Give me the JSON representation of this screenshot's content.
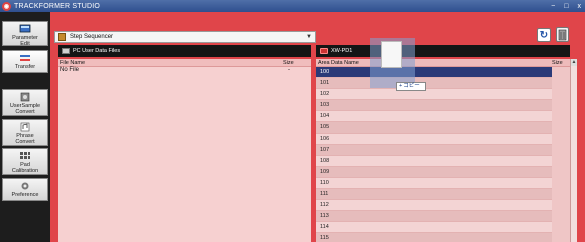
{
  "window": {
    "title": "TRACKFORMER STUDIO",
    "controls": [
      "−",
      "□",
      "x"
    ]
  },
  "sidebar": {
    "items": [
      {
        "label": "Parameter\nEdit",
        "icon": "parameter-edit-icon"
      },
      {
        "label": "Transfer",
        "icon": "transfer-icon"
      },
      {
        "label": "UserSample\nConvert",
        "icon": "usersample-convert-icon"
      },
      {
        "label": "Phrase\nConvert",
        "icon": "phrase-convert-icon"
      },
      {
        "label": "Pad\nCalibration",
        "icon": "pad-calibration-icon"
      },
      {
        "label": "Preference",
        "icon": "preference-icon"
      }
    ]
  },
  "toolbar": {
    "sequencer_select": "Step Sequencer"
  },
  "left_panel": {
    "title": "PC User Data Files",
    "columns": {
      "name": "File Name",
      "size": "Size"
    },
    "rows": [
      {
        "name": "No File",
        "size": "-"
      }
    ]
  },
  "right_panel": {
    "title": "XW-PD1",
    "columns": {
      "area": "Area",
      "name": "Data Name",
      "size": "Size"
    },
    "rows": [
      "100",
      "101",
      "102",
      "103",
      "104",
      "105",
      "106",
      "107",
      "108",
      "109",
      "110",
      "111",
      "112",
      "113",
      "114",
      "115"
    ],
    "selected": "100"
  },
  "drag": {
    "tooltip": "コピー"
  },
  "colors": {
    "main_bg": "#e0454a",
    "selected_row": "#2b3a78"
  }
}
